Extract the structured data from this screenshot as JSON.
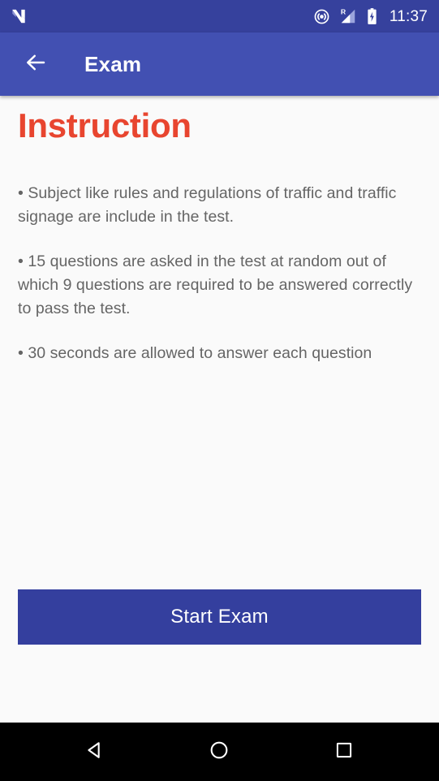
{
  "status_bar": {
    "background_color": "#36419d",
    "logo_icon": "android-nougat-logo-icon",
    "icons": [
      {
        "name": "hotspot-icon",
        "label": "Hotspot"
      },
      {
        "name": "signal-roaming-icon",
        "label": "R"
      },
      {
        "name": "battery-charging-icon",
        "label": "Charging"
      }
    ],
    "clock": "11:37"
  },
  "app_bar": {
    "background_color": "#4250b2",
    "back_icon": "arrow-back-icon",
    "title": "Exam"
  },
  "content": {
    "heading": "Instruction",
    "heading_color": "#e8452f",
    "background_color": "#fafafa",
    "instructions": [
      "• Subject like rules and regulations of traffic and traffic signage are include in the test.",
      "• 15 questions are asked in the test at random out of which 9 questions are required to be answered correctly to pass the test.",
      "• 30 seconds are allowed to answer each question"
    ]
  },
  "primary_action": {
    "label": "Start Exam",
    "background_color": "#343f9e",
    "text_color": "#ffffff"
  },
  "nav_bar": {
    "background_color": "#000000",
    "buttons": [
      {
        "name": "nav-back-button",
        "icon": "triangle-back-icon"
      },
      {
        "name": "nav-home-button",
        "icon": "circle-home-icon"
      },
      {
        "name": "nav-recents-button",
        "icon": "square-recents-icon"
      }
    ]
  }
}
